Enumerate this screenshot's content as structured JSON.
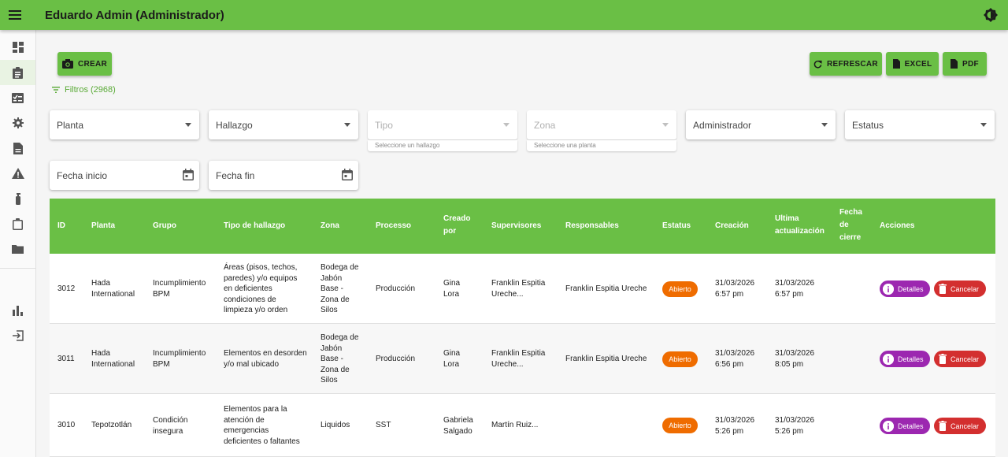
{
  "header": {
    "title": "Eduardo Admin (Administrador)"
  },
  "sidebar": {
    "items": [
      {
        "icon": "dashboard-icon"
      },
      {
        "icon": "assignment-icon",
        "active": true
      },
      {
        "icon": "checklist-icon"
      },
      {
        "icon": "settings-icon"
      },
      {
        "icon": "description-icon"
      },
      {
        "icon": "warning-icon"
      },
      {
        "icon": "fire-extinguisher-icon"
      },
      {
        "icon": "clipboard-icon"
      },
      {
        "icon": "folder-icon"
      },
      {
        "icon": "bar-chart-icon"
      },
      {
        "icon": "logout-icon"
      }
    ]
  },
  "toolbar": {
    "create_label": "CREAR",
    "refresh_label": "REFRESCAR",
    "excel_label": "EXCEL",
    "pdf_label": "PDF",
    "filters_label": "Filtros (2968)"
  },
  "filters": {
    "planta": "Planta",
    "hallazgo": "Hallazgo",
    "tipo": "Tipo",
    "tipo_helper": "Seleccione un hallazgo",
    "zona": "Zona",
    "zona_helper": "Seleccione una planta",
    "administrador": "Administrador",
    "estatus": "Estatus",
    "fecha_inicio": "Fecha inicio",
    "fecha_fin": "Fecha fin"
  },
  "table": {
    "headers": {
      "id": "ID",
      "planta": "Planta",
      "grupo": "Grupo",
      "tipo": "Tipo de hallazgo",
      "zona": "Zona",
      "proceso": "Processo",
      "creado_1": "Creado",
      "creado_2": "por",
      "supervisores": "Supervisores",
      "responsables": "Responsables",
      "estatus": "Estatus",
      "creacion": "Creación",
      "ultima_1": "Ultima",
      "ultima_2": "actualización",
      "cierre_1": "Fecha",
      "cierre_2": "de",
      "cierre_3": "cierre",
      "acciones": "Acciones"
    },
    "rows": [
      {
        "id": "3012",
        "planta": [
          "Hada",
          "International"
        ],
        "grupo": [
          "Incumplimiento",
          "BPM"
        ],
        "tipo": [
          "Áreas (pisos, techos,",
          "paredes) y/o equipos",
          "en deficientes",
          "condiciones de",
          "limpieza y/o orden"
        ],
        "zona": [
          "Bodega de",
          "Jabón",
          "Base -",
          "Zona de",
          "Silos"
        ],
        "proceso": "Producción",
        "creado": [
          "Gina",
          "Lora"
        ],
        "supervisores": [
          "Franklin Espitia",
          "Ureche..."
        ],
        "responsables": "Franklin Espitia Ureche",
        "estatus": "Abierto",
        "creacion": [
          "31/03/2026",
          "6:57 pm"
        ],
        "ultima": [
          "31/03/2026",
          "6:57 pm"
        ],
        "detalles": "Detalles",
        "cancelar": "Cancelar"
      },
      {
        "id": "3011",
        "planta": [
          "Hada",
          "International"
        ],
        "grupo": [
          "Incumplimiento",
          "BPM"
        ],
        "tipo": [
          "Elementos en desorden",
          "y/o mal ubicado"
        ],
        "zona": [
          "Bodega de",
          "Jabón",
          "Base -",
          "Zona de",
          "Silos"
        ],
        "proceso": "Producción",
        "creado": [
          "Gina",
          "Lora"
        ],
        "supervisores": [
          "Franklin Espitia",
          "Ureche..."
        ],
        "responsables": "Franklin Espitia Ureche",
        "estatus": "Abierto",
        "creacion": [
          "31/03/2026",
          "6:56 pm"
        ],
        "ultima": [
          "31/03/2026",
          "8:05 pm"
        ],
        "detalles": "Detalles",
        "cancelar": "Cancelar"
      },
      {
        "id": "3010",
        "planta": [
          "Tepotzotlán"
        ],
        "grupo": [
          "Condición",
          "insegura"
        ],
        "tipo": [
          "Elementos para la",
          "atención de",
          "emergencias",
          "deficientes o faltantes"
        ],
        "zona": [
          "Liquidos"
        ],
        "proceso": "SST",
        "creado": [
          "Gabriela",
          "Salgado"
        ],
        "supervisores": [
          "Martín Ruiz..."
        ],
        "responsables": "",
        "estatus": "Abierto",
        "creacion": [
          "31/03/2026",
          "5:26 pm"
        ],
        "ultima": [
          "31/03/2026",
          "5:26 pm"
        ],
        "detalles": "Detalles",
        "cancelar": "Cancelar"
      }
    ]
  }
}
